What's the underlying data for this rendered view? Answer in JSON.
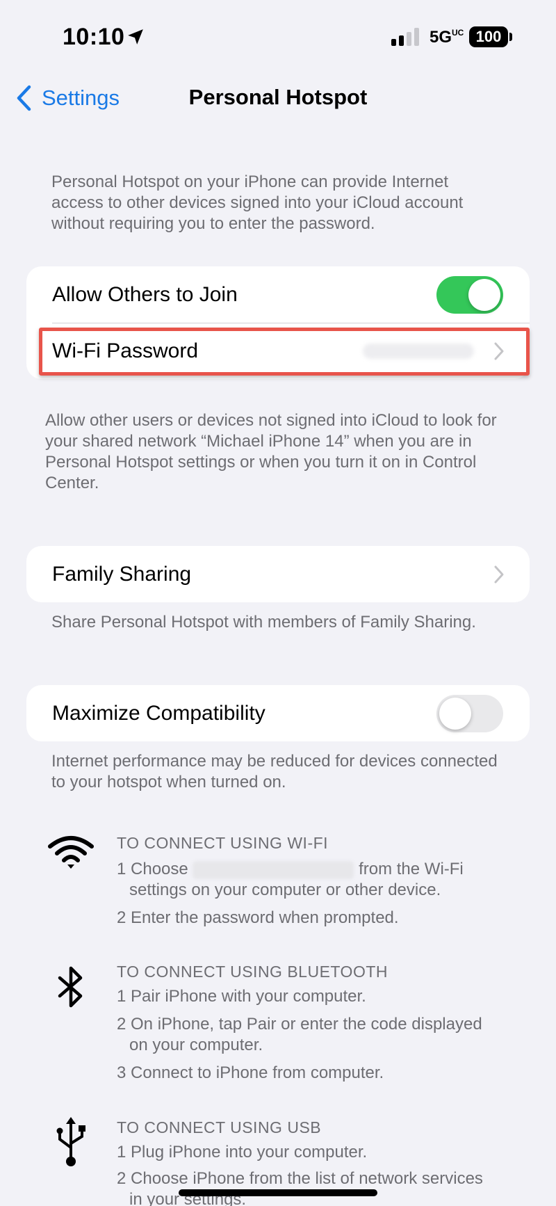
{
  "status_bar": {
    "time": "10:10",
    "network": "5G",
    "network_sub": "UC",
    "battery": "100"
  },
  "nav": {
    "back_label": "Settings",
    "title": "Personal Hotspot"
  },
  "intro_text": "Personal Hotspot on your iPhone can provide Internet access to other devices signed into your iCloud account without requiring you to enter the password.",
  "join_group": {
    "allow_label": "Allow Others to Join",
    "allow_on": true,
    "wifi_password_label": "Wi-Fi Password"
  },
  "join_footnote": "Allow other users or devices not signed into iCloud to look for your shared network “Michael iPhone 14” when you are in Personal Hotspot settings or when you turn it on in Control Center.",
  "family_sharing": {
    "label": "Family Sharing",
    "footnote": "Share Personal Hotspot with members of Family Sharing."
  },
  "maximize": {
    "label": "Maximize Compatibility",
    "on": false,
    "footnote": "Internet performance may be reduced for devices connected to your hotspot when turned on."
  },
  "wifi_section": {
    "heading": "TO CONNECT USING WI-FI",
    "step1_prefix": "1 Choose",
    "step1_suffix": "from the Wi-Fi",
    "step1_cont": "settings on your computer or other device.",
    "step2": "2 Enter the password when prompted."
  },
  "bluetooth_section": {
    "heading": "TO CONNECT USING BLUETOOTH",
    "step1": "1 Pair iPhone with your computer.",
    "step2": "2 On iPhone, tap Pair or enter the code displayed",
    "step2_cont": "on your computer.",
    "step3": "3 Connect to iPhone from computer."
  },
  "usb_section": {
    "heading": "TO CONNECT USING USB",
    "step1": "1 Plug iPhone into your computer.",
    "step2": "2 Choose iPhone from the list of network services",
    "step2_cont": "in your settings."
  },
  "colors": {
    "accent": "#1a7ae6",
    "toggle_on": "#34c759",
    "highlight": "#e8544a"
  }
}
